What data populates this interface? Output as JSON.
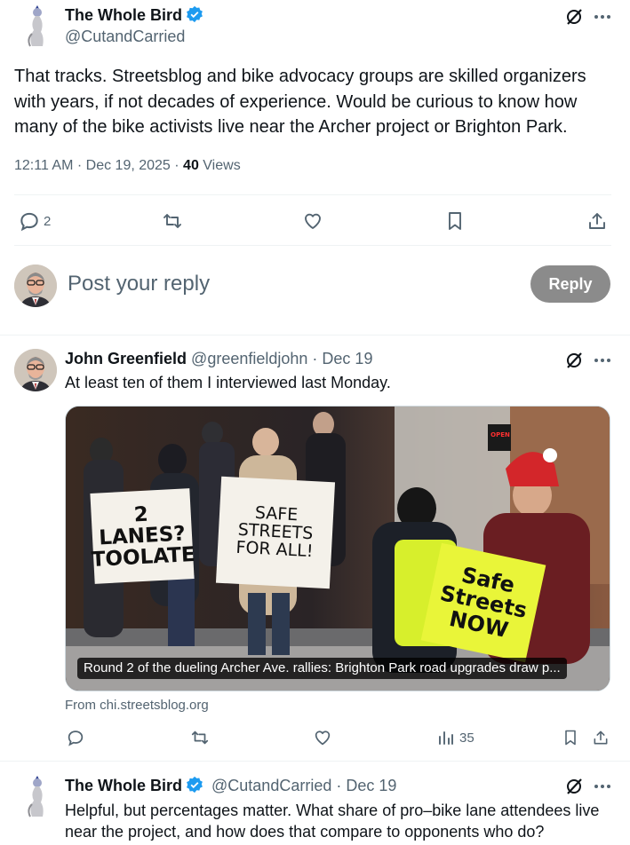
{
  "tweet": {
    "author_name": "The Whole Bird",
    "author_handle": "@CutandCarried",
    "text": "That tracks. Streetsblog and bike advocacy groups are skilled organizers with years, if not decades of experience. Would be curious to know how many of the bike activists live near the Archer project or Brighton Park.",
    "time": "12:11 AM",
    "date": "Dec 19, 2025",
    "views_count": "40",
    "views_label": "Views",
    "reply_count": "2"
  },
  "composer": {
    "placeholder": "Post your reply",
    "reply_button": "Reply"
  },
  "reply1": {
    "author_name": "John Greenfield",
    "author_handle": "@greenfieldjohn",
    "date": "Dec 19",
    "text": "At least ten of them I interviewed last Monday.",
    "card_title": "Round 2 of the dueling Archer Ave. rallies: Brighton Park road upgrades draw p...",
    "card_source": "From chi.streetsblog.org",
    "views_count": "35",
    "signs": {
      "two_lanes": "2 LANES? TOOLATE",
      "safe_streets": "SAFE STREETS FOR ALL!",
      "safe_now": "Safe Streets NOW",
      "open": "OPEN"
    }
  },
  "reply2": {
    "author_name": "The Whole Bird",
    "author_handle": "@CutandCarried",
    "date": "Dec 19",
    "text": "Helpful, but percentages matter. What share of pro–bike lane attendees live near the project, and how does that compare to opponents who do?"
  },
  "icons": {
    "verified": "verified-badge-icon",
    "grok": "grok-icon",
    "more": "more-icon",
    "reply": "reply-icon",
    "retweet": "retweet-icon",
    "like": "like-icon",
    "bookmark": "bookmark-icon",
    "share": "share-icon",
    "views": "views-icon"
  },
  "colors": {
    "accent": "#1d9bf0",
    "text": "#0f1419",
    "muted": "#536471",
    "reply_button_bg": "#8b8b8b",
    "divider": "#eff3f4"
  }
}
